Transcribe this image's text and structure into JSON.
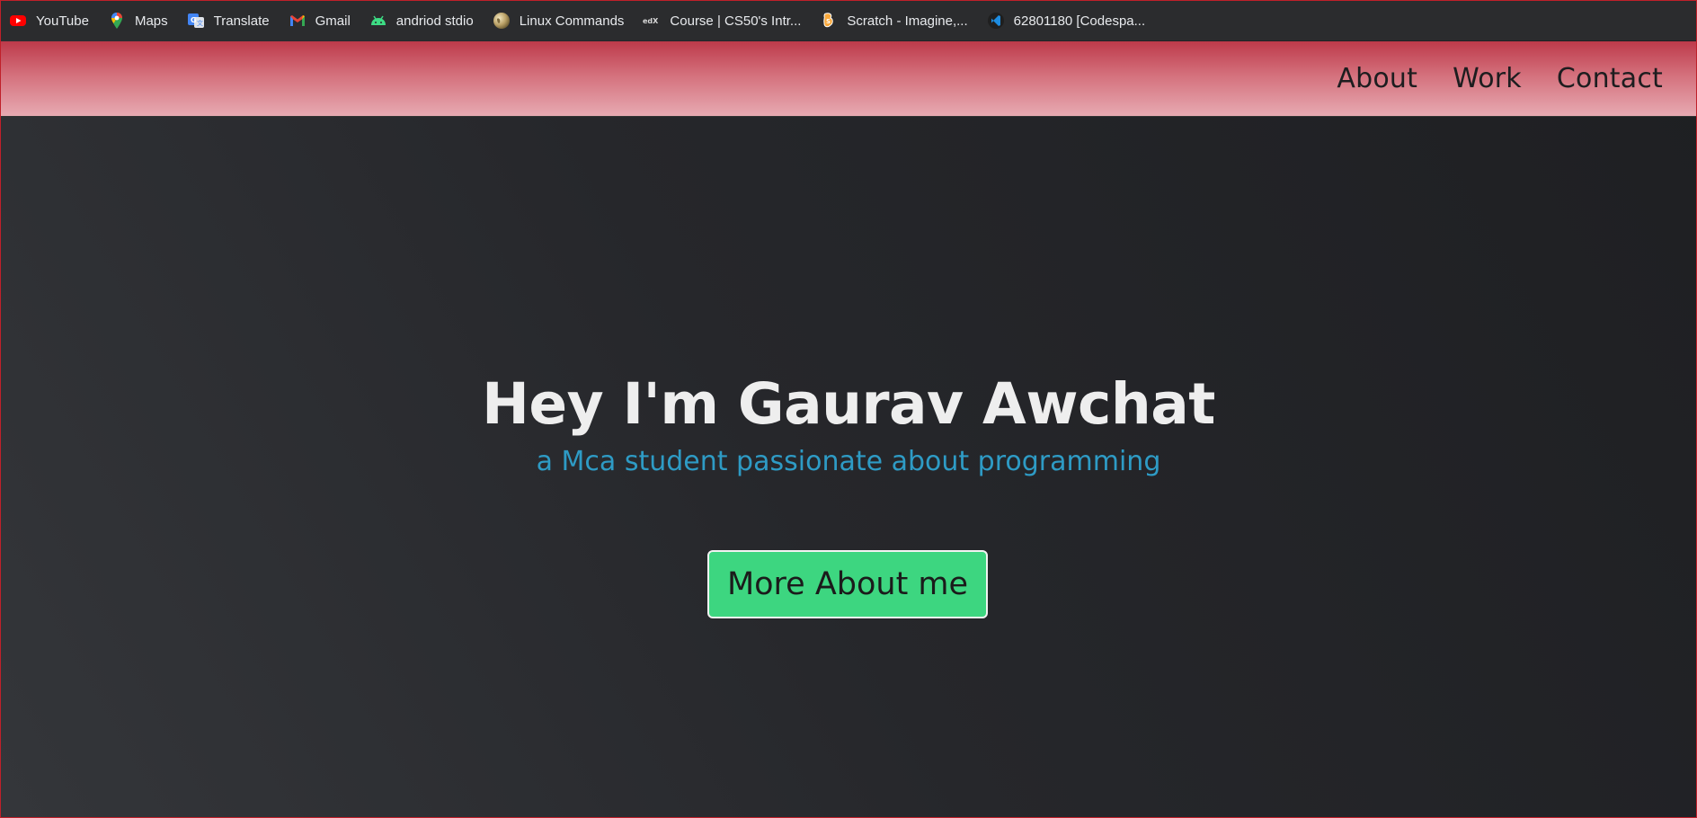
{
  "bookmarks": [
    {
      "label": "YouTube",
      "icon": "youtube-icon"
    },
    {
      "label": "Maps",
      "icon": "maps-pin-icon"
    },
    {
      "label": "Translate",
      "icon": "translate-icon"
    },
    {
      "label": "Gmail",
      "icon": "gmail-icon"
    },
    {
      "label": "andriod stdio",
      "icon": "android-icon"
    },
    {
      "label": "Linux Commands",
      "icon": "globe-icon"
    },
    {
      "label": "Course | CS50's Intr...",
      "icon": "edx-icon"
    },
    {
      "label": "Scratch - Imagine,...",
      "icon": "scratch-icon"
    },
    {
      "label": "62801180 [Codespa...",
      "icon": "vscode-icon"
    }
  ],
  "nav": {
    "about": "About",
    "work": "Work",
    "contact": "Contact"
  },
  "hero": {
    "title": "Hey I'm Gaurav Awchat",
    "subtitle": "a Mca student passionate about programming",
    "button_label": "More About me"
  },
  "colors": {
    "navbar_top": "#bd3a4a",
    "navbar_bottom": "#e7aab2",
    "subtitle": "#2e9bc5",
    "button_bg": "#3dd680",
    "background": "#26272b"
  }
}
